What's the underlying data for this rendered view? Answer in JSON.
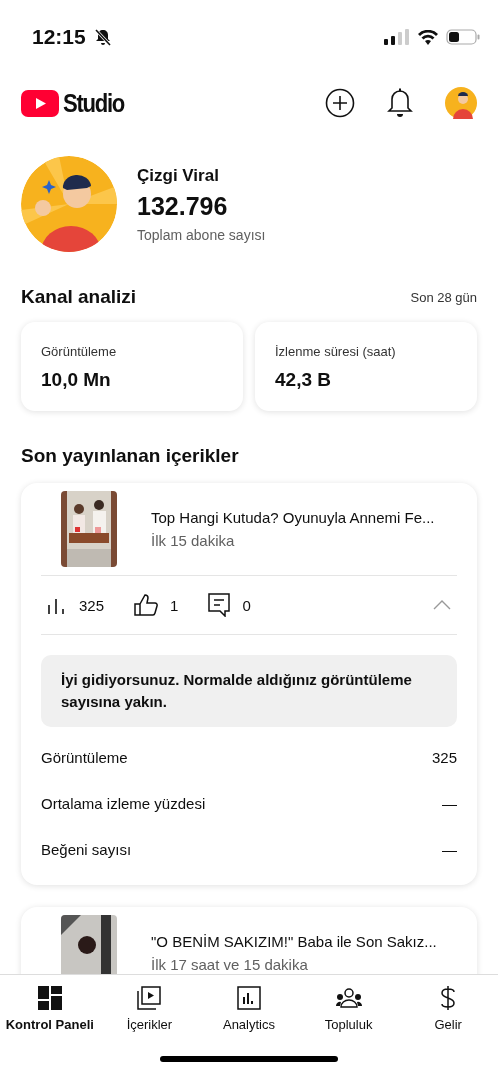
{
  "status_bar": {
    "time": "12:15"
  },
  "header": {
    "logo_text": "Studio"
  },
  "channel": {
    "name": "Çizgi Viral",
    "subscribers": "132.796",
    "subscribers_label": "Toplam abone sayısı"
  },
  "analytics": {
    "title": "Kanal analizi",
    "period": "Son 28 gün",
    "cards": [
      {
        "label": "Görüntüleme",
        "value": "10,0 Mn"
      },
      {
        "label": "İzlenme süresi (saat)",
        "value": "42,3 B"
      }
    ]
  },
  "recent": {
    "title": "Son yayınlanan içerikler",
    "items": [
      {
        "title": "Top Hangi Kutuda? Oyunuyla Annemi Fe...",
        "subtitle": "İlk 15 dakika",
        "views": "325",
        "likes": "1",
        "comments": "0",
        "expanded": true,
        "message": "İyi gidiyorsunuz. Normalde aldığınız görüntüleme sayısına yakın.",
        "metrics": [
          {
            "label": "Görüntüleme",
            "value": "325"
          },
          {
            "label": "Ortalama izleme yüzdesi",
            "value": "—"
          },
          {
            "label": "Beğeni sayısı",
            "value": "—"
          }
        ]
      },
      {
        "title": "\"O BENİM SAKIZIM!\" Baba ile Son Sakız...",
        "subtitle": "İlk 17 saat ve 15 dakika"
      }
    ]
  },
  "nav": [
    {
      "label": "Kontrol Paneli",
      "kind": "dashboard",
      "selected": true
    },
    {
      "label": "İçerikler",
      "kind": "content",
      "selected": false
    },
    {
      "label": "Analytics",
      "kind": "analytics",
      "selected": false
    },
    {
      "label": "Topluluk",
      "kind": "community",
      "selected": false
    },
    {
      "label": "Gelir",
      "kind": "earn",
      "selected": false
    }
  ]
}
